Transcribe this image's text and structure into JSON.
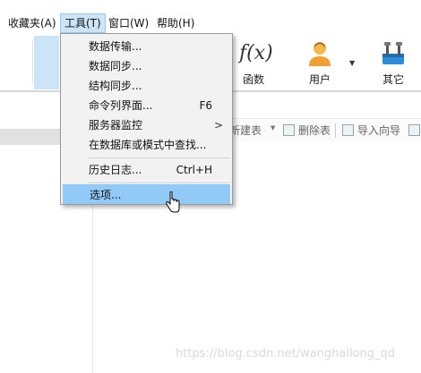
{
  "menubar": {
    "items": [
      {
        "label": "收藏夹(A)"
      },
      {
        "label": "工具(T)"
      },
      {
        "label": "窗口(W)"
      },
      {
        "label": "帮助(H)"
      }
    ],
    "active_index": 1
  },
  "ribbon": {
    "buttons": [
      {
        "label": "函数",
        "icon": "function-icon"
      },
      {
        "label": "用户",
        "icon": "user-icon"
      },
      {
        "label": "其它",
        "icon": "tools-icon"
      }
    ]
  },
  "subbar": {
    "new_table": "新建表",
    "delete_table": "删除表",
    "import_wizard": "导入向导"
  },
  "dropdown": {
    "items": [
      {
        "label": "数据传输...",
        "shortcut": ""
      },
      {
        "label": "数据同步...",
        "shortcut": ""
      },
      {
        "label": "结构同步...",
        "shortcut": ""
      },
      {
        "label": "命令列界面...",
        "shortcut": "F6"
      },
      {
        "label": "服务器监控",
        "shortcut": ""
      },
      {
        "label": "在数据库或模式中查找...",
        "shortcut": ""
      },
      {
        "label": "历史日志...",
        "shortcut": "Ctrl+H"
      },
      {
        "label": "选项...",
        "shortcut": ""
      }
    ],
    "submenu_arrow": ">",
    "highlighted_index": 7
  },
  "watermark": "https://blog.csdn.net/wanghailong_qd",
  "colors": {
    "menu_highlight": "#91c9f7",
    "menubar_active": "#cce4f7",
    "menu_background": "#f2f2f2"
  }
}
